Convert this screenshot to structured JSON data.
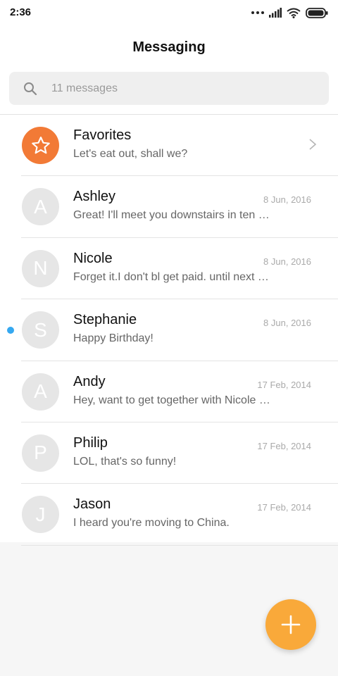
{
  "status_bar": {
    "time": "2:36",
    "icons": [
      "more-dots-icon",
      "signal-icon",
      "wifi-icon",
      "battery-icon"
    ]
  },
  "header": {
    "title": "Messaging"
  },
  "search": {
    "placeholder": "11 messages",
    "value": ""
  },
  "favorites": {
    "name": "Favorites",
    "preview": "Let's eat out, shall we?",
    "icon": "star-icon",
    "color": "#f27a36"
  },
  "conversations": [
    {
      "initial": "A",
      "name": "Ashley",
      "preview": "Great! I'll meet you downstairs in ten minutes.",
      "date": "8 Jun, 2016",
      "unread": false
    },
    {
      "initial": "N",
      "name": "Nicole",
      "preview": "Forget it.I don't bl get paid. until next Friday.",
      "date": "8 Jun, 2016",
      "unread": false
    },
    {
      "initial": "S",
      "name": "Stephanie",
      "preview": "Happy Birthday!",
      "date": "8 Jun, 2016",
      "unread": true
    },
    {
      "initial": "A",
      "name": "Andy",
      "preview": "Hey, want to get together with Nicole tonight?",
      "date": "17 Feb, 2014",
      "unread": false
    },
    {
      "initial": "P",
      "name": "Philip",
      "preview": "LOL, that's so funny!",
      "date": "17 Feb, 2014",
      "unread": false
    },
    {
      "initial": "J",
      "name": "Jason",
      "preview": "I heard you're moving to China.",
      "date": "17 Feb, 2014",
      "unread": false
    }
  ],
  "fab": {
    "icon": "plus-icon",
    "color": "#f9a93a"
  },
  "colors": {
    "unread_indicator": "#35a8f0",
    "avatar_default": "#e6e6e6",
    "background": "#f6f6f6"
  }
}
